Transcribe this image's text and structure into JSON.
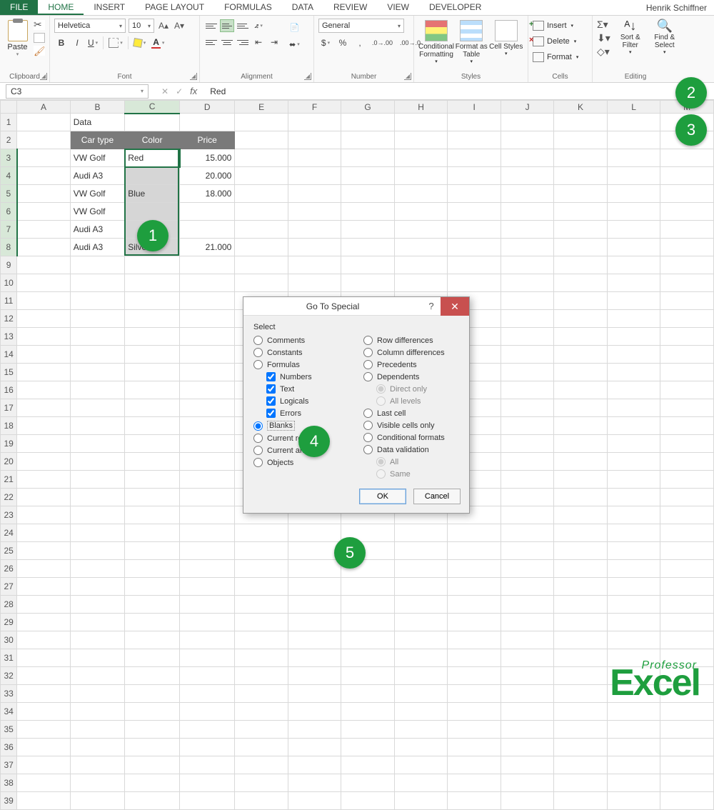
{
  "user": "Henrik Schiffner",
  "tabs": [
    "FILE",
    "HOME",
    "INSERT",
    "PAGE LAYOUT",
    "FORMULAS",
    "DATA",
    "REVIEW",
    "VIEW",
    "DEVELOPER"
  ],
  "active_tab": "HOME",
  "ribbon": {
    "clipboard": {
      "paste": "Paste",
      "label": "Clipboard"
    },
    "font": {
      "name": "Helvetica",
      "size": "10",
      "label": "Font"
    },
    "alignment": {
      "label": "Alignment"
    },
    "number": {
      "format": "General",
      "label": "Number"
    },
    "styles": {
      "cf": "Conditional Formatting",
      "ft": "Format as Table",
      "cs": "Cell Styles",
      "label": "Styles"
    },
    "cells": {
      "insert": "Insert",
      "delete": "Delete",
      "format": "Format",
      "label": "Cells"
    },
    "editing": {
      "sort": "Sort & Filter",
      "find": "Find & Select",
      "label": "Editing"
    }
  },
  "name_box": "C3",
  "formula_value": "Red",
  "columns": [
    "A",
    "B",
    "C",
    "D",
    "E",
    "F",
    "G",
    "H",
    "I",
    "J",
    "K",
    "L",
    "M"
  ],
  "selected_col": "C",
  "selected_rows": [
    3,
    4,
    5,
    6,
    7,
    8
  ],
  "data_title": "Data",
  "table": {
    "headers": [
      "Car type",
      "Color",
      "Price"
    ],
    "rows": [
      {
        "car": "VW Golf",
        "color": "Red",
        "price": "15.000"
      },
      {
        "car": "Audi A3",
        "color": "",
        "price": "20.000"
      },
      {
        "car": "VW Golf",
        "color": "Blue",
        "price": "18.000"
      },
      {
        "car": "VW Golf",
        "color": "",
        "price": ""
      },
      {
        "car": "Audi A3",
        "color": "",
        "price": ""
      },
      {
        "car": "Audi A3",
        "color": "Silver",
        "price": "21.000"
      }
    ]
  },
  "dialog": {
    "title": "Go To Special",
    "section": "Select",
    "left": [
      {
        "key": "comments",
        "label": "Comments",
        "type": "radio"
      },
      {
        "key": "constants",
        "label": "Constants",
        "type": "radio"
      },
      {
        "key": "formulas",
        "label": "Formulas",
        "type": "radio"
      },
      {
        "key": "numbers",
        "label": "Numbers",
        "type": "check",
        "sub": true,
        "checked": true
      },
      {
        "key": "text",
        "label": "Text",
        "type": "check",
        "sub": true,
        "checked": true
      },
      {
        "key": "logicals",
        "label": "Logicals",
        "type": "check",
        "sub": true,
        "checked": true
      },
      {
        "key": "errors",
        "label": "Errors",
        "type": "check",
        "sub": true,
        "checked": true
      },
      {
        "key": "blanks",
        "label": "Blanks",
        "type": "radio",
        "selected": true
      },
      {
        "key": "curreg",
        "label": "Current region",
        "type": "radio"
      },
      {
        "key": "curarr",
        "label": "Current array",
        "type": "radio"
      },
      {
        "key": "objects",
        "label": "Objects",
        "type": "radio"
      }
    ],
    "right": [
      {
        "key": "rowdiff",
        "label": "Row differences",
        "type": "radio"
      },
      {
        "key": "coldiff",
        "label": "Column differences",
        "type": "radio"
      },
      {
        "key": "prec",
        "label": "Precedents",
        "type": "radio"
      },
      {
        "key": "dep",
        "label": "Dependents",
        "type": "radio"
      },
      {
        "key": "direct",
        "label": "Direct only",
        "type": "radio",
        "sub": true,
        "checked": true,
        "disabled": true
      },
      {
        "key": "all",
        "label": "All levels",
        "type": "radio",
        "sub": true,
        "disabled": true
      },
      {
        "key": "last",
        "label": "Last cell",
        "type": "radio"
      },
      {
        "key": "visible",
        "label": "Visible cells only",
        "type": "radio"
      },
      {
        "key": "condfmt",
        "label": "Conditional formats",
        "type": "radio"
      },
      {
        "key": "dataval",
        "label": "Data validation",
        "type": "radio"
      },
      {
        "key": "dvall",
        "label": "All",
        "type": "radio",
        "sub": true,
        "checked": true,
        "disabled": true
      },
      {
        "key": "dvsame",
        "label": "Same",
        "type": "radio",
        "sub": true,
        "disabled": true
      }
    ],
    "ok": "OK",
    "cancel": "Cancel"
  },
  "callouts": {
    "1": "1",
    "2": "2",
    "3": "3",
    "4": "4",
    "5": "5"
  },
  "logo": {
    "top": "Professor",
    "bottom": "Excel"
  }
}
